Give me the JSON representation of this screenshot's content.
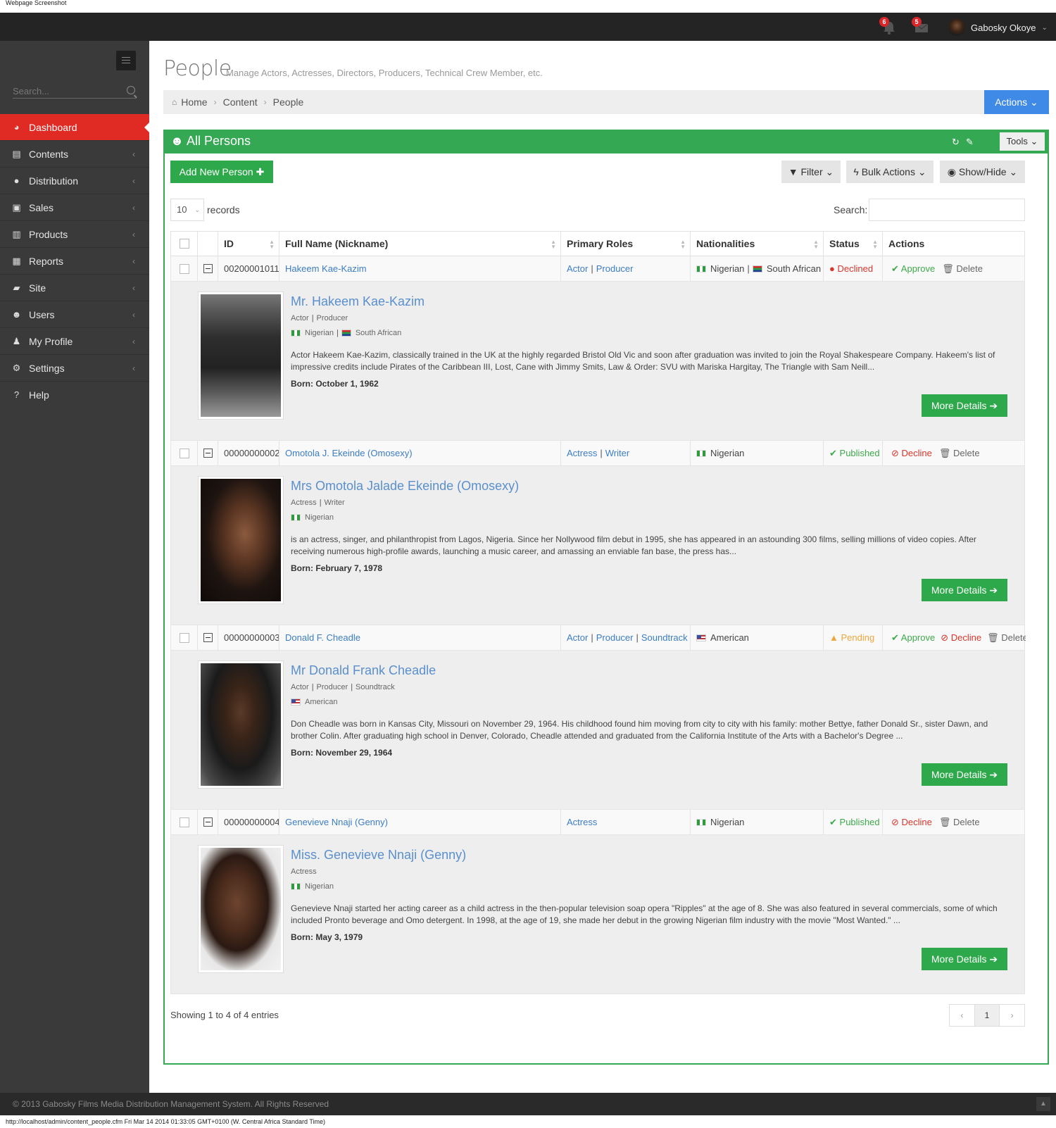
{
  "window": {
    "capture_label": "Webpage Screenshot",
    "status_url": "http://localhost/admin/content_people.cfm Fri Mar 14 2014 01:33:05 GMT+0100 (W. Central Africa Standard Time)"
  },
  "topbar": {
    "alerts_count": "6",
    "messages_count": "5",
    "user_name": "Gabosky Okoye"
  },
  "sidebar": {
    "search_placeholder": "Search...",
    "items": [
      {
        "label": "Dashboard",
        "icon": "dashboard-icon"
      },
      {
        "label": "Contents",
        "icon": "file-icon"
      },
      {
        "label": "Distribution",
        "icon": "globe-icon"
      },
      {
        "label": "Sales",
        "icon": "money-icon"
      },
      {
        "label": "Products",
        "icon": "briefcase-icon"
      },
      {
        "label": "Reports",
        "icon": "bar-chart-icon"
      },
      {
        "label": "Site",
        "icon": "folder-open-icon"
      },
      {
        "label": "Users",
        "icon": "group-icon"
      },
      {
        "label": "My Profile",
        "icon": "user-icon"
      },
      {
        "label": "Settings",
        "icon": "cogs-icon"
      },
      {
        "label": "Help",
        "icon": "question-icon"
      }
    ]
  },
  "header": {
    "title": "People",
    "subtitle": "Manage Actors, Actresses, Directors, Producers, Technical Crew Member, etc.",
    "breadcrumb": [
      "Home",
      "Content",
      "People"
    ],
    "actions_label": "Actions"
  },
  "portlet": {
    "title": "All Persons",
    "tools_label": "Tools",
    "add_label": "Add New Person",
    "filter_label": "Filter",
    "bulk_label": "Bulk Actions",
    "showhide_label": "Show/Hide",
    "page_length": "10",
    "records_label": "records",
    "search_label": "Search:",
    "columns": [
      "ID",
      "Full Name (Nickname)",
      "Primary Roles",
      "Nationalities",
      "Status",
      "Actions"
    ],
    "rows": [
      {
        "id": "00200001011",
        "name": "Hakeem Kae-Kazim",
        "roles": [
          "Actor",
          "Producer"
        ],
        "nats": [
          "Nigerian",
          "South African"
        ],
        "status": "Declined",
        "actions": [
          "Approve",
          "Delete"
        ],
        "detail": {
          "full_name": "Mr. Hakeem Kae-Kazim",
          "roles": [
            "Actor",
            "Producer"
          ],
          "nats": [
            "Nigerian",
            "South African"
          ],
          "bio": "Actor Hakeem Kae-Kazim, classically trained in the UK at the highly regarded Bristol Old Vic and soon after graduation was invited to join the Royal Shakespeare Company. Hakeem's list of impressive credits include Pirates of the Caribbean III, Lost, Cane with Jimmy Smits, Law & Order: SVU with Mariska Hargitay, The Triangle with Sam Neill...",
          "born": "Born: October 1, 1962",
          "more": "More Details"
        }
      },
      {
        "id": "00000000002",
        "name": "Omotola J. Ekeinde (Omosexy)",
        "roles": [
          "Actress",
          "Writer"
        ],
        "nats": [
          "Nigerian"
        ],
        "status": "Published",
        "actions": [
          "Decline",
          "Delete"
        ],
        "detail": {
          "full_name": "Mrs Omotola Jalade Ekeinde (Omosexy)",
          "roles": [
            "Actress",
            "Writer"
          ],
          "nats": [
            "Nigerian"
          ],
          "bio": "is an actress, singer, and philanthropist from Lagos, Nigeria. Since her Nollywood film debut in 1995, she has appeared in an astounding 300 films, selling millions of video copies. After receiving numerous high-profile awards, launching a music career, and amassing an enviable fan base, the press has...",
          "born": "Born: February 7, 1978",
          "more": "More Details"
        }
      },
      {
        "id": "00000000003",
        "name": "Donald F. Cheadle",
        "roles": [
          "Actor",
          "Producer",
          "Soundtrack"
        ],
        "nats": [
          "American"
        ],
        "status": "Pending",
        "actions": [
          "Approve",
          "Decline",
          "Delete"
        ],
        "detail": {
          "full_name": "Mr Donald Frank Cheadle",
          "roles": [
            "Actor",
            "Producer",
            "Soundtrack"
          ],
          "nats": [
            "American"
          ],
          "bio": "Don Cheadle was born in Kansas City, Missouri on November 29, 1964. His childhood found him moving from city to city with his family: mother Bettye, father Donald Sr., sister Dawn, and brother Colin. After graduating high school in Denver, Colorado, Cheadle attended and graduated from the California Institute of the Arts with a Bachelor's Degree ...",
          "born": "Born: November 29, 1964",
          "more": "More Details"
        }
      },
      {
        "id": "00000000004",
        "name": "Genevieve Nnaji (Genny)",
        "roles": [
          "Actress"
        ],
        "nats": [
          "Nigerian"
        ],
        "status": "Published",
        "actions": [
          "Decline",
          "Delete"
        ],
        "detail": {
          "full_name": "Miss. Genevieve Nnaji (Genny)",
          "roles": [
            "Actress"
          ],
          "nats": [
            "Nigerian"
          ],
          "bio": "Genevieve Nnaji started her acting career as a child actress in the then-popular television soap opera \"Ripples\" at the age of 8. She was also featured in several commercials, some of which included Pronto beverage and Omo detergent. In 1998, at the age of 19, she made her debut in the growing Nigerian film industry with the movie \"Most Wanted.\" ...",
          "born": "Born: May 3, 1979",
          "more": "More Details"
        }
      }
    ],
    "showing": "Showing 1 to 4 of 4 entries",
    "pager": {
      "prev": "‹",
      "current": "1",
      "next": "›"
    }
  },
  "footer": {
    "text": "© 2013 Gabosky Films Media Distribution Management System. All Rights Reserved"
  },
  "colors": {
    "accent_red": "#e02a24",
    "success_green": "#34a853",
    "primary_blue": "#3f8ae6"
  }
}
